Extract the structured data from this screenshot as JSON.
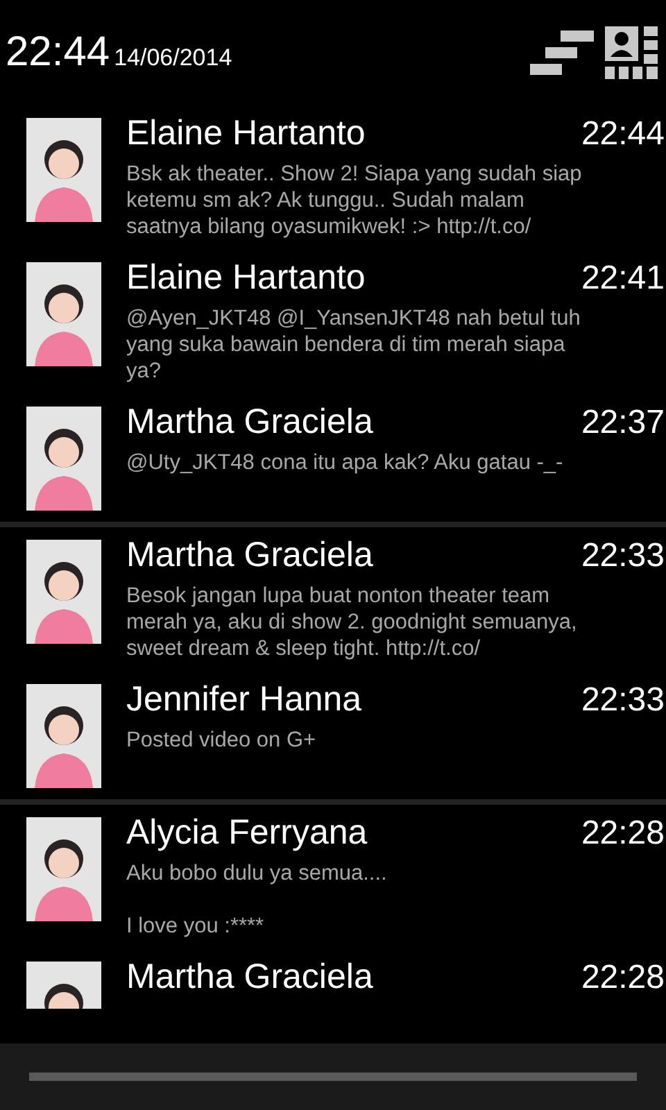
{
  "header": {
    "time": "22:44",
    "date": "14/06/2014"
  },
  "groups": [
    {
      "items": [
        {
          "name": "Elaine Hartanto",
          "time": "22:44",
          "message": "Bsk ak theater.. Show 2! Siapa yang sudah siap\nketemu sm ak?  Ak tunggu.. Sudah malam\nsaatnya bilang oyasumikwek! :> http://t.co/"
        },
        {
          "name": "Elaine Hartanto",
          "time": "22:41",
          "message": "@Ayen_JKT48 @I_YansenJKT48 nah betul tuh\nyang suka bawain bendera di tim merah siapa\nya?"
        },
        {
          "name": "Martha Graciela",
          "time": "22:37",
          "message": "@Uty_JKT48 cona itu apa kak? Aku gatau -_-"
        }
      ]
    },
    {
      "items": [
        {
          "name": "Martha Graciela",
          "time": "22:33",
          "message": "Besok jangan lupa buat nonton theater team\nmerah ya, aku di show 2. goodnight semuanya,\nsweet dream & sleep tight. http://t.co/"
        },
        {
          "name": "Jennifer Hanna",
          "time": "22:33",
          "message": "Posted video on G+"
        }
      ]
    },
    {
      "items": [
        {
          "name": "Alycia Ferryana",
          "time": "22:28",
          "message": "Aku bobo dulu ya semua....\n\nI love you :****"
        },
        {
          "name": "Martha Graciela",
          "time": "22:28"
        }
      ]
    }
  ]
}
